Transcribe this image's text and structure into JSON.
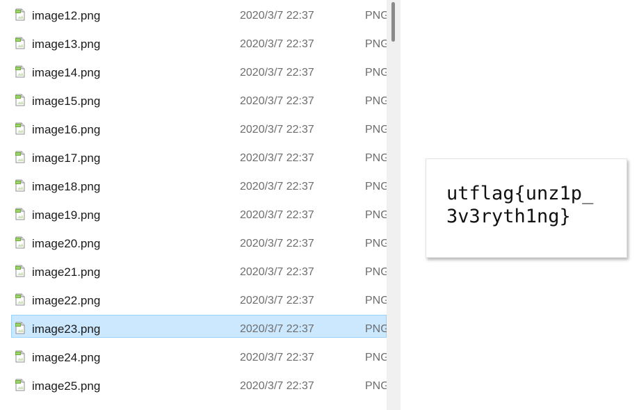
{
  "file_list": {
    "items": [
      {
        "name": "image12.png",
        "date": "2020/3/7 22:37",
        "type": "PNG",
        "selected": false
      },
      {
        "name": "image13.png",
        "date": "2020/3/7 22:37",
        "type": "PNG",
        "selected": false
      },
      {
        "name": "image14.png",
        "date": "2020/3/7 22:37",
        "type": "PNG",
        "selected": false
      },
      {
        "name": "image15.png",
        "date": "2020/3/7 22:37",
        "type": "PNG",
        "selected": false
      },
      {
        "name": "image16.png",
        "date": "2020/3/7 22:37",
        "type": "PNG",
        "selected": false
      },
      {
        "name": "image17.png",
        "date": "2020/3/7 22:37",
        "type": "PNG",
        "selected": false
      },
      {
        "name": "image18.png",
        "date": "2020/3/7 22:37",
        "type": "PNG",
        "selected": false
      },
      {
        "name": "image19.png",
        "date": "2020/3/7 22:37",
        "type": "PNG",
        "selected": false
      },
      {
        "name": "image20.png",
        "date": "2020/3/7 22:37",
        "type": "PNG",
        "selected": false
      },
      {
        "name": "image21.png",
        "date": "2020/3/7 22:37",
        "type": "PNG",
        "selected": false
      },
      {
        "name": "image22.png",
        "date": "2020/3/7 22:37",
        "type": "PNG",
        "selected": false
      },
      {
        "name": "image23.png",
        "date": "2020/3/7 22:37",
        "type": "PNG",
        "selected": true
      },
      {
        "name": "image24.png",
        "date": "2020/3/7 22:37",
        "type": "PNG",
        "selected": false
      },
      {
        "name": "image25.png",
        "date": "2020/3/7 22:37",
        "type": "PNG",
        "selected": false
      }
    ],
    "icon": "png-image-file-icon"
  },
  "flag_card": {
    "line1": "utflag{unz1p_",
    "line2": "3v3ryth1ng}"
  },
  "colors": {
    "selection_fill": "#cce8ff",
    "selection_border": "#99d1ff",
    "secondary_text": "#6d6d6d"
  }
}
